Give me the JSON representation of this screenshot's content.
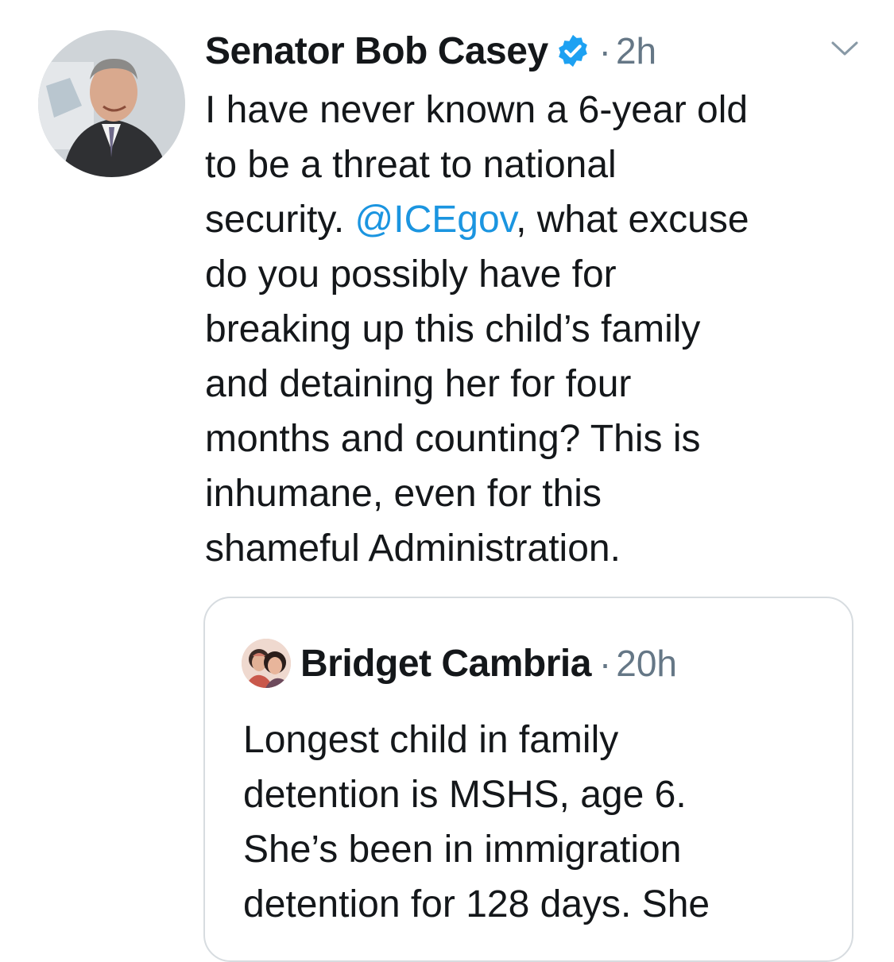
{
  "tweet": {
    "author": {
      "display_name": "Senator Bob Casey",
      "verified": true,
      "avatar": "profile-photo-man-in-suit"
    },
    "timestamp": "2h",
    "separator": "·",
    "menu_icon": "chevron-down-icon",
    "text_lines": [
      "I have never known a 6-year old",
      "to be a threat to national",
      "security.",
      "do you possibly have for",
      "breaking up this child’s family",
      "and detaining her for four",
      "months and counting? This is",
      "inhumane, even for this",
      "shameful Administration."
    ],
    "mention": "@ICEgov",
    "mention_suffix": ", what excuse"
  },
  "quoted_tweet": {
    "author": {
      "display_name": "Bridget Cambria",
      "avatar": "profile-photo-two-women"
    },
    "timestamp": "20h",
    "separator": "·",
    "text_lines": [
      "Longest child in family",
      "detention is MSHS, age 6.",
      "She’s been in immigration",
      "detention for 128 days. She"
    ]
  },
  "colors": {
    "text": "#14171a",
    "secondary": "#657786",
    "link": "#1b95e0",
    "verified_badge": "#1da1f2",
    "card_border": "#d7dce0"
  }
}
